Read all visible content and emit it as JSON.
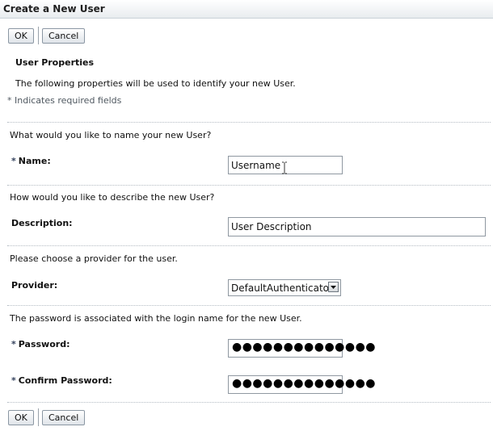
{
  "window": {
    "title": "Create a New User"
  },
  "toolbar": {
    "ok_label": "OK",
    "cancel_label": "Cancel"
  },
  "section": {
    "title": "User Properties",
    "intro": "The following properties will be used to identify your new User.",
    "required_note": "* Indicates required fields"
  },
  "required_marker": "*",
  "fields": {
    "name": {
      "prompt": "What would you like to name your new User?",
      "label": "Name:",
      "value": "Username"
    },
    "description": {
      "prompt": "How would you like to describe the new User?",
      "label": "Description:",
      "value": "User Description"
    },
    "provider": {
      "prompt": "Please choose a provider for the user.",
      "label": "Provider:",
      "value": "DefaultAuthenticator"
    },
    "password": {
      "prompt": "The password is associated with the login name for the new User.",
      "label": "Password:",
      "masked": "●●●●●●●●●●●●●●"
    },
    "confirm_password": {
      "label": "Confirm Password:",
      "masked": "●●●●●●●●●●●●●●"
    }
  },
  "icons": {
    "dropdown": "chevron-down-icon",
    "text_cursor": "text-cursor-icon"
  }
}
